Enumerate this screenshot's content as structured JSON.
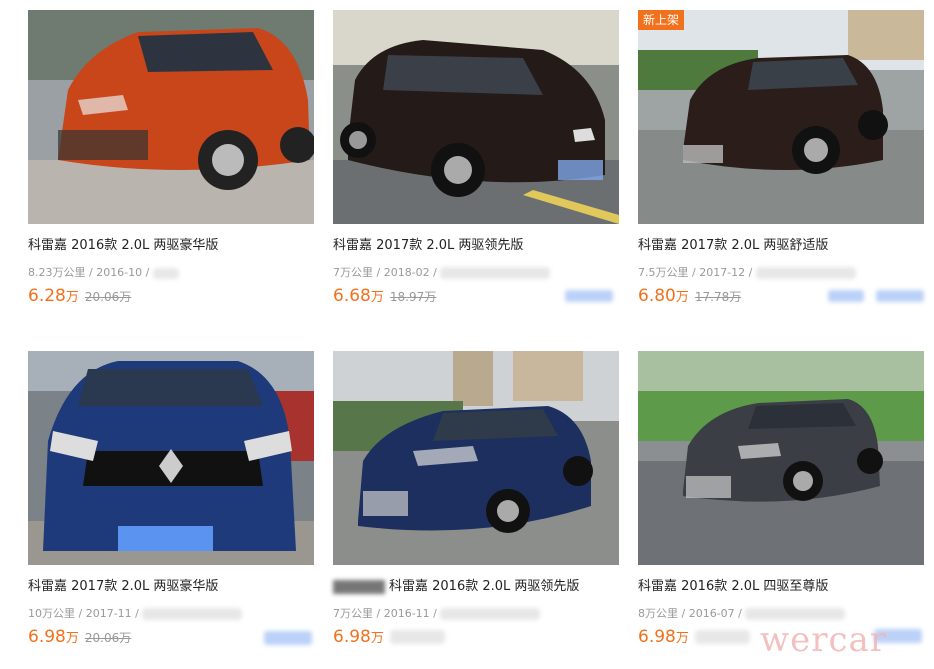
{
  "listings": [
    {
      "badge": "",
      "title": "科雷嘉 2016款 2.0L 两驱豪华版",
      "meta": "8.23万公里 / 2016-10 / ",
      "price": "6.28",
      "unit": "万",
      "old_price": "20.06万",
      "color": "#c8461a"
    },
    {
      "badge": "",
      "title": "科雷嘉 2017款 2.0L 两驱领先版",
      "meta": "7万公里 / 2018-02 / ",
      "price": "6.68",
      "unit": "万",
      "old_price": "18.97万",
      "color": "#241a17"
    },
    {
      "badge": "新上架",
      "title": "科雷嘉 2017款 2.0L 两驱舒适版",
      "meta": "7.5万公里 / 2017-12 / ",
      "price": "6.80",
      "unit": "万",
      "old_price": "17.78万",
      "color": "#2a1d1a"
    },
    {
      "badge": "",
      "title": "科雷嘉 2017款 2.0L 两驱豪华版",
      "meta": "10万公里 / 2017-11 / ",
      "price": "6.98",
      "unit": "万",
      "old_price": "20.06万",
      "color": "#1e3a7a"
    },
    {
      "badge": "",
      "title": "科雷嘉 2016款 2.0L 两驱领先版",
      "meta": "7万公里 / 2016-11 / ",
      "price": "6.98",
      "unit": "万",
      "old_price": "",
      "color": "#1d2f5f"
    },
    {
      "badge": "",
      "title": "科雷嘉 2016款 2.0L 四驱至尊版",
      "meta": "8万公里 / 2016-07 / ",
      "price": "6.98",
      "unit": "万",
      "old_price": "",
      "color": "#3b3f45"
    }
  ],
  "watermark": "wercar"
}
